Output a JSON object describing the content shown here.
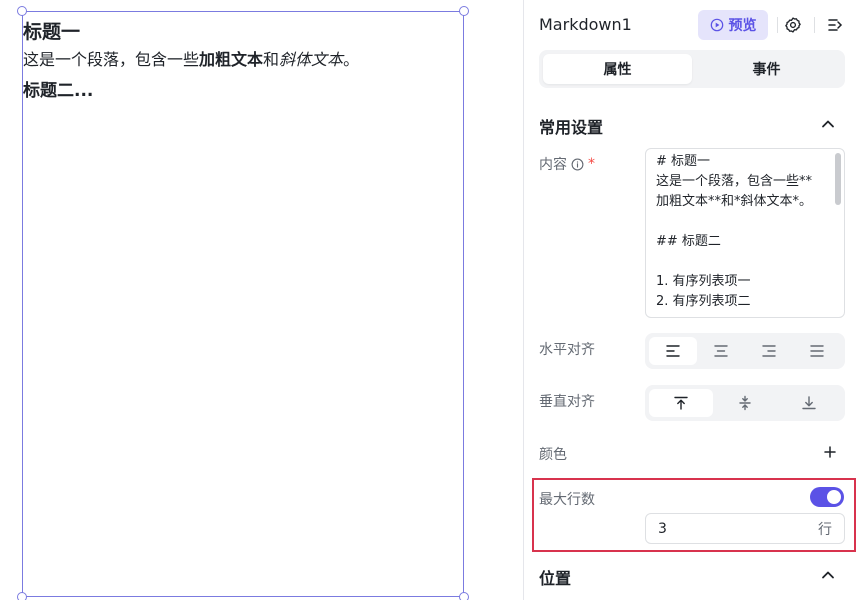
{
  "canvas": {
    "markdown": {
      "h1": "标题一",
      "p_before": "这是一个段落，包含一些",
      "p_bold": "加粗文本",
      "p_mid": "和",
      "p_italic": "斜体文本",
      "p_after": "。",
      "h2": "标题二..."
    }
  },
  "panel": {
    "title": "Markdown1",
    "preview_label": "预览",
    "tabs": [
      {
        "label": "属性",
        "active": true
      },
      {
        "label": "事件",
        "active": false
      }
    ],
    "common_section": {
      "title": "常用设置",
      "content_label": "内容",
      "required_mark": "*",
      "content_value": "# 标题一\n这是一个段落，包含一些**加粗文本**和*斜体文本*。\n\n## 标题二\n\n1. 有序列表项一\n2. 有序列表项二",
      "h_align_label": "水平对齐",
      "v_align_label": "垂直对齐",
      "color_label": "颜色",
      "max_lines_label": "最大行数",
      "max_lines_enabled": true,
      "max_lines_value": "3",
      "max_lines_suffix": "行"
    },
    "position_section": {
      "title": "位置"
    }
  },
  "colors": {
    "accent": "#5b52e6",
    "accent_bg": "#e5e4fb",
    "highlight": "#d8334d",
    "selection": "#7b7be0"
  }
}
